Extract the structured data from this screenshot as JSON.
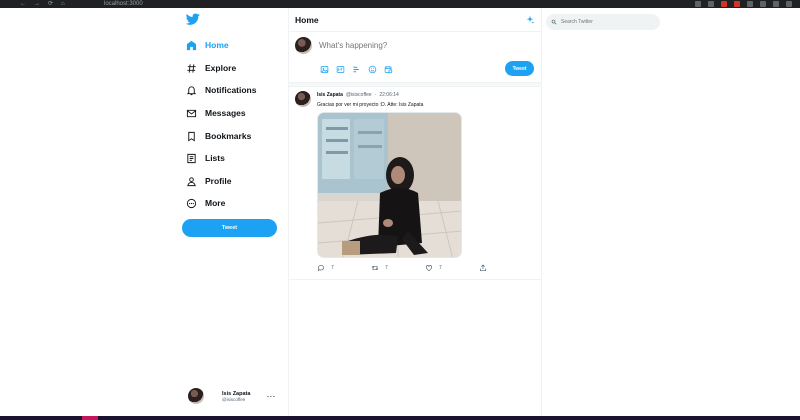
{
  "browser": {
    "url": "localhost:3000"
  },
  "sidebar": {
    "items": [
      {
        "label": "Home",
        "icon": "home-icon"
      },
      {
        "label": "Explore",
        "icon": "hashtag-icon"
      },
      {
        "label": "Notifications",
        "icon": "bell-icon"
      },
      {
        "label": "Messages",
        "icon": "mail-icon"
      },
      {
        "label": "Bookmarks",
        "icon": "bookmark-icon"
      },
      {
        "label": "Lists",
        "icon": "list-icon"
      },
      {
        "label": "Profile",
        "icon": "user-icon"
      },
      {
        "label": "More",
        "icon": "more-circle-icon"
      }
    ],
    "tweet_button": "Tweet",
    "profile": {
      "name": "Isis Zapata",
      "handle": "@isiscoffee"
    }
  },
  "main": {
    "title": "Home",
    "composer": {
      "placeholder": "What's happening?",
      "tweet_button": "Tweet"
    },
    "tweets": [
      {
        "author": "Isis Zapata",
        "handle": "@isiscoffee",
        "separator": "·",
        "time": "22:06:14",
        "text": "Gracias por ver mi proyecto :D. Atte: Isis Zapata",
        "replies": "7",
        "retweets": "7",
        "likes": "7"
      }
    ]
  },
  "search": {
    "placeholder": "Search Twitter"
  },
  "colors": {
    "accent": "#1da1f2",
    "text": "#0f1419",
    "muted": "#536471"
  }
}
